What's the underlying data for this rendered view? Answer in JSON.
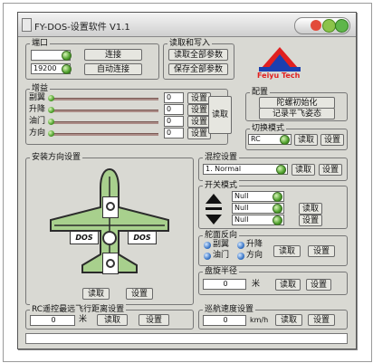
{
  "window": {
    "title": "FY-DOS-设置软件 V1.1"
  },
  "port": {
    "label": "端口",
    "port_value": "",
    "baud_value": "19200",
    "connect_button": "连接",
    "auto_connect_button": "自动连接"
  },
  "read_write": {
    "label": "读取和写入",
    "read_all_button": "读取全部参数",
    "save_all_button": "保存全部参数"
  },
  "logo": {
    "text": "Feiyu Tech",
    "brand_color": "#e02020"
  },
  "gain": {
    "label": "增益",
    "rows": [
      {
        "name": "副翼",
        "value": "0",
        "set": "设置"
      },
      {
        "name": "升降",
        "value": "0",
        "set": "设置"
      },
      {
        "name": "油门",
        "value": "0",
        "set": "设置"
      },
      {
        "name": "方向",
        "value": "0",
        "set": "设置"
      }
    ],
    "read_button": "读取"
  },
  "config": {
    "label": "配置",
    "gyro_init_button": "陀螺初始化",
    "record_level_button": "记录平飞姿态"
  },
  "switch_mode": {
    "label": "切换模式",
    "value": "RC",
    "read_button": "读取",
    "set_button": "设置"
  },
  "mixing": {
    "label": "混控设置",
    "value": "1. Normal",
    "read_button": "读取",
    "set_button": "设置"
  },
  "install": {
    "label": "安装方向设置",
    "read_button": "读取",
    "set_button": "设置",
    "dos_label": "DOS"
  },
  "switch_modes": {
    "label": "开关模式",
    "values": [
      "Null",
      "Null",
      "Null"
    ],
    "read_button": "读取",
    "set_button": "设置"
  },
  "servo_dir": {
    "label": "舵面反向",
    "options": [
      "副翼",
      "升降",
      "油门",
      "方向"
    ],
    "read_button": "读取",
    "set_button": "设置"
  },
  "circle_radius": {
    "label": "盘旋半径",
    "value": "0",
    "unit": "米",
    "read_button": "读取",
    "set_button": "设置"
  },
  "rc_distance": {
    "label": "RC遥控最远飞行距离设置",
    "value": "0",
    "unit": "米",
    "read_button": "读取",
    "set_button": "设置"
  },
  "cruise_speed": {
    "label": "巡航速度设置",
    "value": "0",
    "unit": "km/h",
    "read_button": "读取",
    "set_button": "设置"
  },
  "colors": {
    "led_green": "#4fa12c",
    "led_blue": "#3d78c8",
    "plane_fill": "#a8d08d"
  }
}
